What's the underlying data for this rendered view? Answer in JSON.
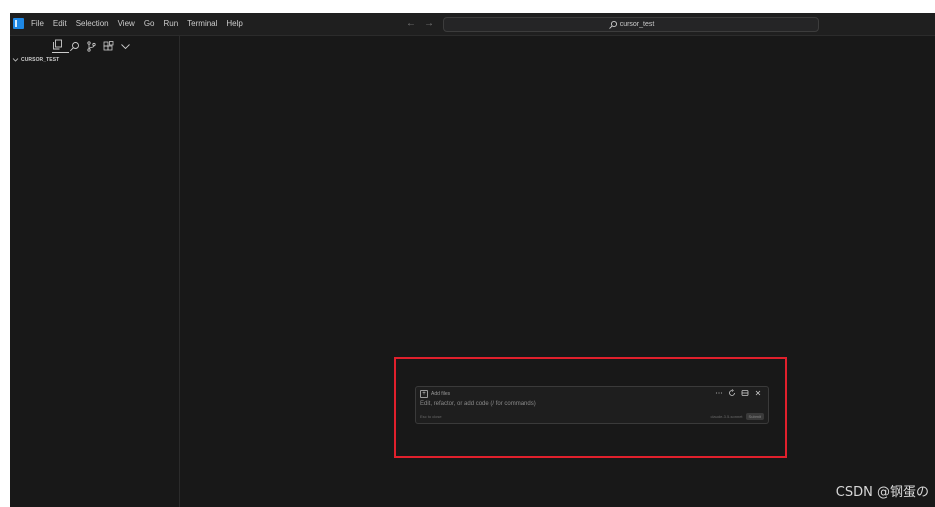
{
  "menu": {
    "items": [
      "File",
      "Edit",
      "Selection",
      "View",
      "Go",
      "Run",
      "Terminal",
      "Help"
    ]
  },
  "nav": {
    "back_glyph": "←",
    "forward_glyph": "→"
  },
  "search": {
    "text": "cursor_test",
    "icon": "search-icon"
  },
  "activity_bar": {
    "icons": [
      "explorer-icon",
      "search-icon",
      "source-control-icon",
      "extensions-icon",
      "chevron-down-icon"
    ],
    "active": "explorer-icon"
  },
  "explorer": {
    "folder_name": "CURSOR_TEST"
  },
  "composer": {
    "add_files_label": "Add files",
    "placeholder": "Edit, refactor, or add code (/ for commands)",
    "esc_hint": "Esc to close",
    "model_name": "claude-3.5-sonnet",
    "submit_label": "Submit",
    "tool_icons": [
      "more-icon",
      "history-icon",
      "layout-icon",
      "close-icon"
    ]
  },
  "watermark": "CSDN @钢蛋の",
  "colors": {
    "background": "#181818",
    "titlebar": "#1f1f1f",
    "text": "#cccccc",
    "highlight": "#e0202c",
    "logo": "#1e88e5"
  }
}
